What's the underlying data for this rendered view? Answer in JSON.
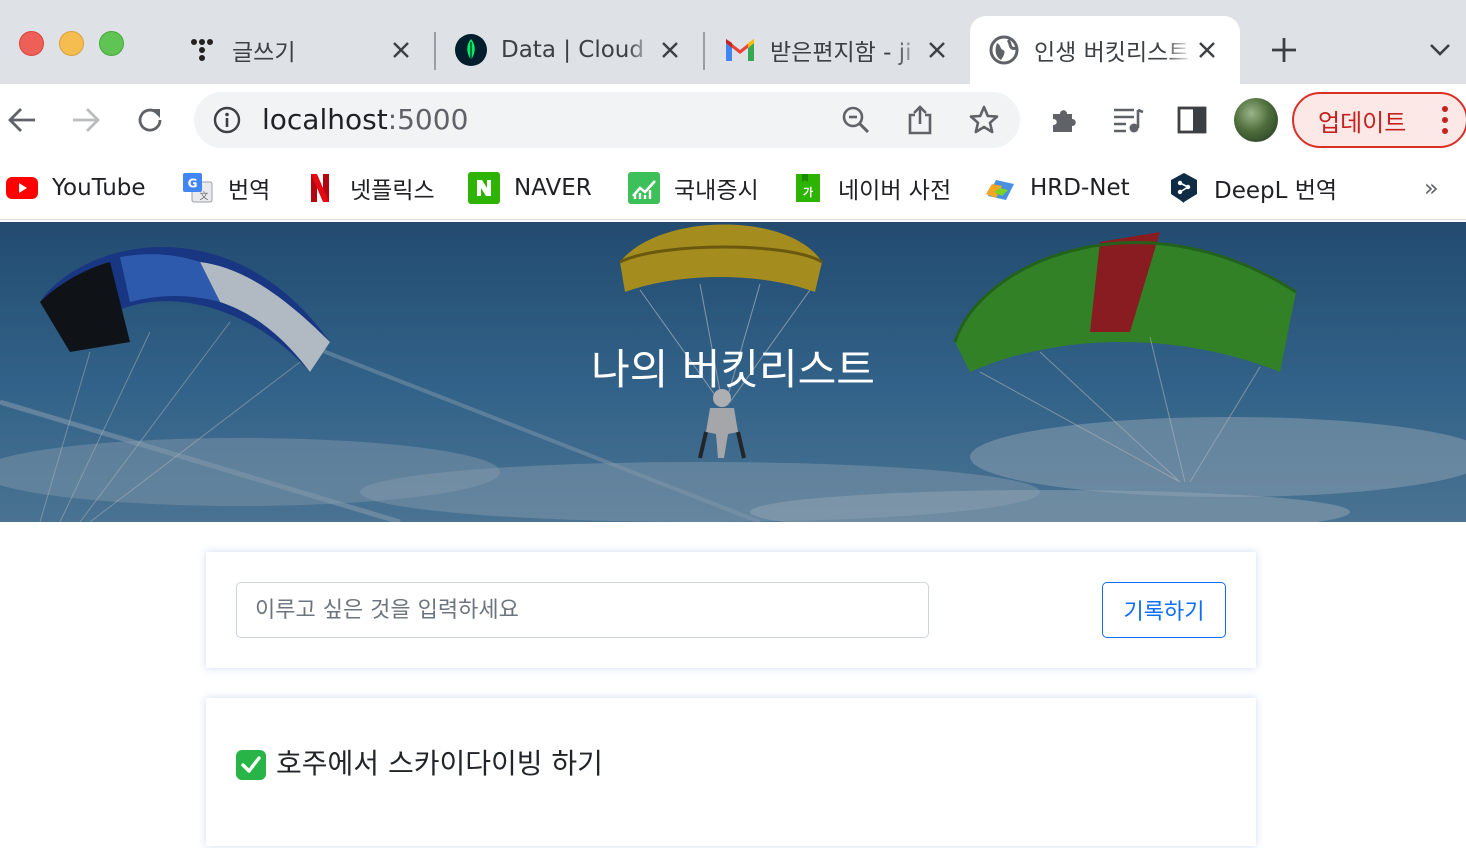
{
  "browser": {
    "tabs": [
      {
        "title": "글쓰기",
        "favicon": "tistory-icon",
        "active": false
      },
      {
        "title": "Data | Cloud",
        "favicon": "mongodb-leaf-icon",
        "active": false
      },
      {
        "title": "받은편지함 - ji",
        "favicon": "gmail-icon",
        "active": false
      },
      {
        "title": "인생 버킷리스트",
        "favicon": "globe-icon",
        "active": true
      }
    ],
    "address": {
      "host": "localhost",
      "port": ":5000"
    },
    "update_label": "업데이트",
    "bookmarks": [
      {
        "label": "YouTube",
        "icon": "youtube-icon"
      },
      {
        "label": "번역",
        "icon": "google-translate-icon"
      },
      {
        "label": "넷플릭스",
        "icon": "netflix-icon"
      },
      {
        "label": "NAVER",
        "icon": "naver-icon"
      },
      {
        "label": "국내증시",
        "icon": "naver-stock-icon"
      },
      {
        "label": "네이버 사전",
        "icon": "naver-dictionary-icon"
      },
      {
        "label": "HRD-Net",
        "icon": "hrd-net-icon"
      },
      {
        "label": "DeepL 번역",
        "icon": "deepl-icon"
      }
    ],
    "bookmarks_more": "»"
  },
  "page": {
    "hero_title": "나의 버킷리스트",
    "input_placeholder": "이루고 싶은 것을 입력하세요",
    "submit_label": "기록하기",
    "items": [
      {
        "text": "호주에서 스카이다이빙 하기",
        "done": true
      }
    ]
  },
  "colors": {
    "accent": "#0d6efd",
    "update_red": "#c5221f",
    "check_green": "#28b446",
    "tabstrip": "#dee1e6"
  }
}
